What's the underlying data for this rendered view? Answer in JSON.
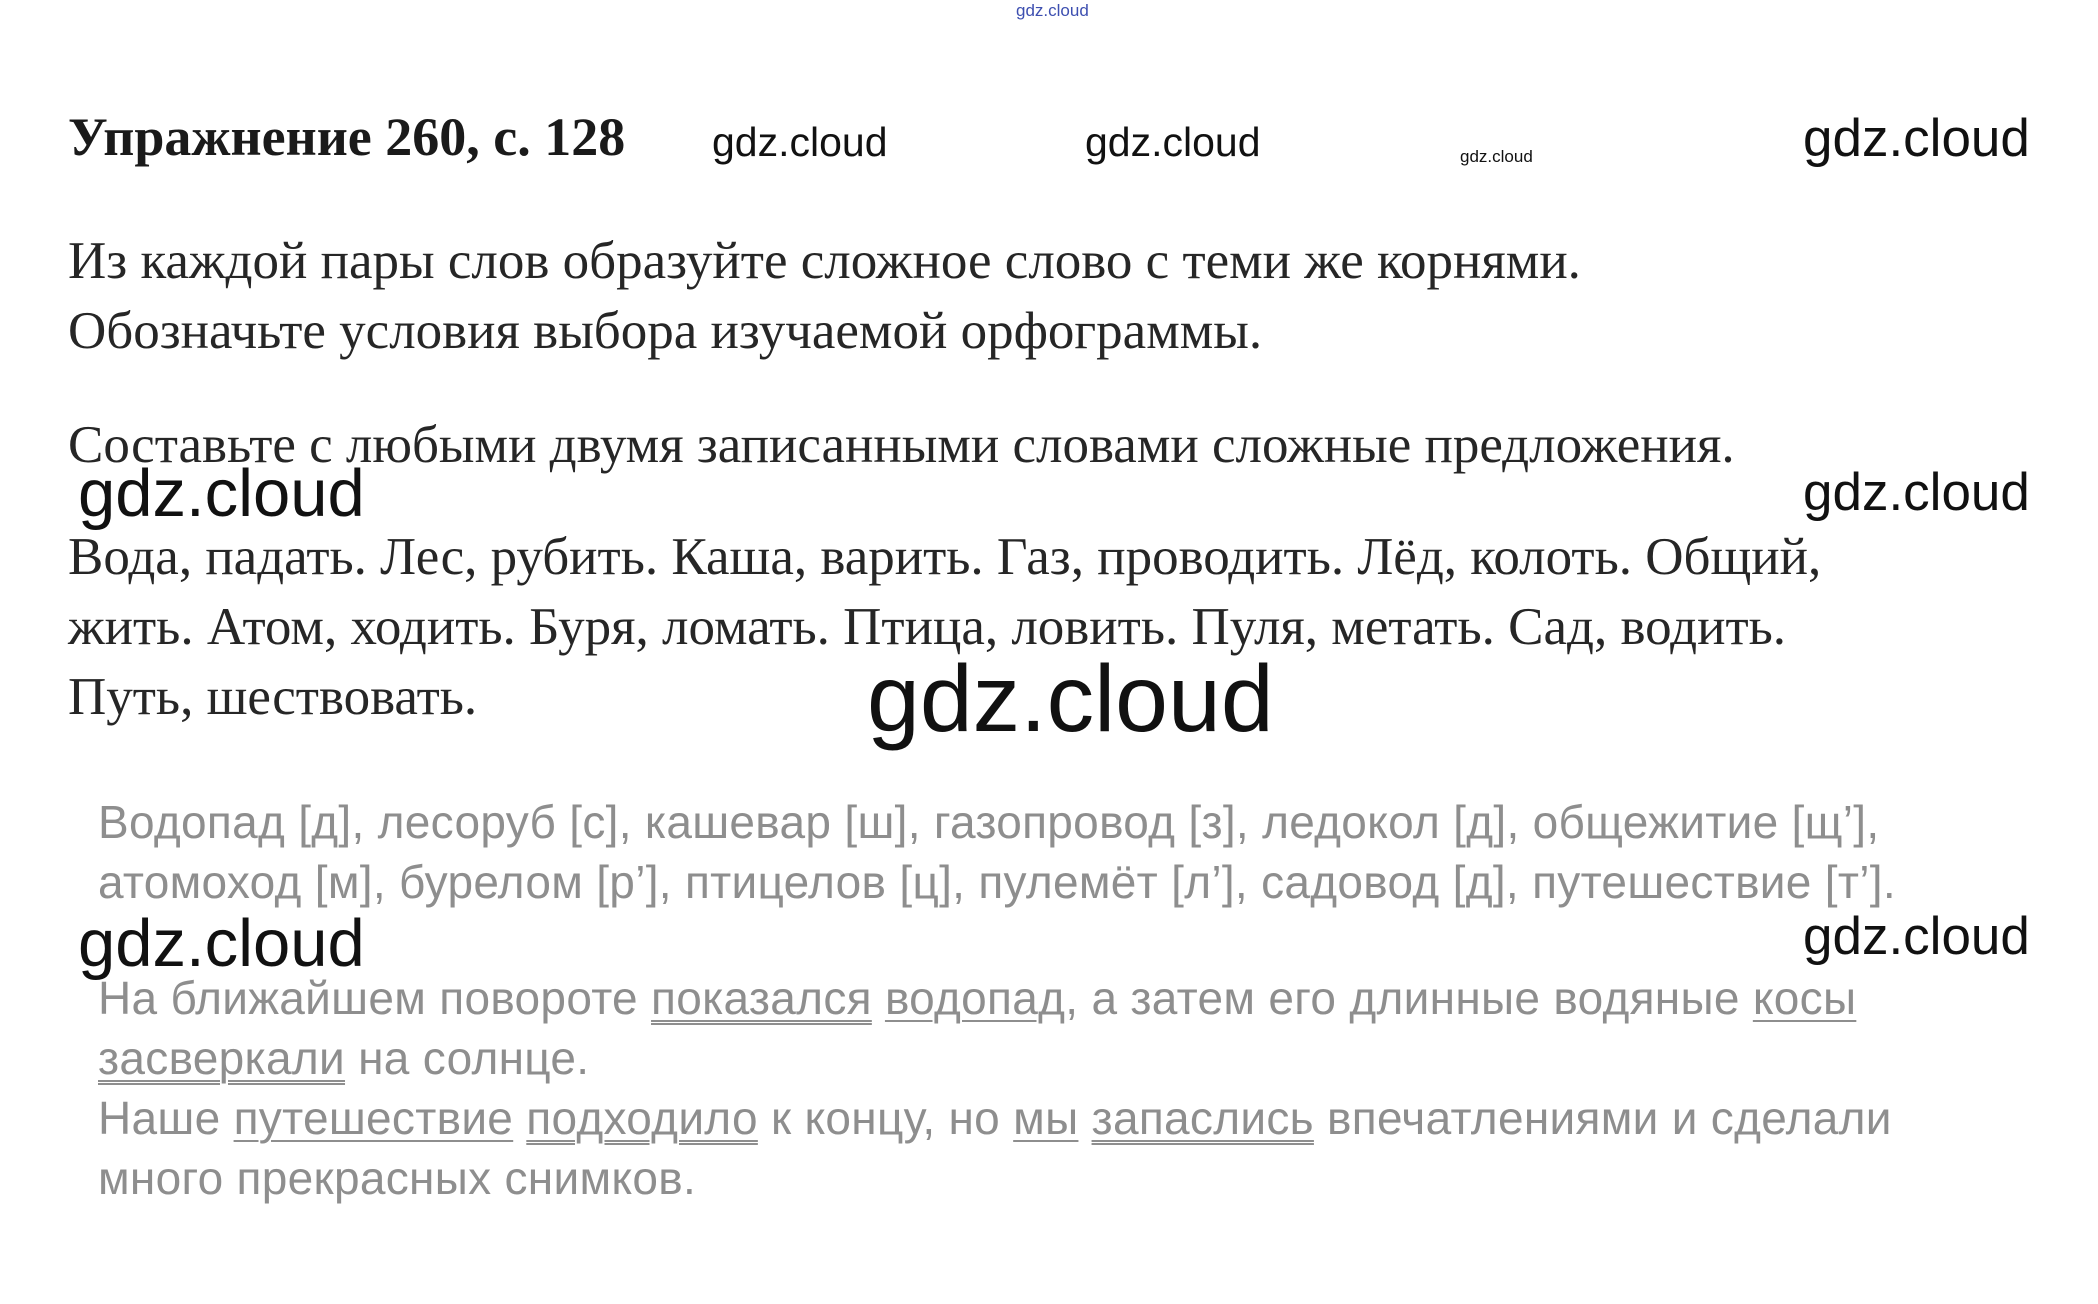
{
  "watermark": "gdz.cloud",
  "title": "Упражнение 260, с. 128",
  "task": {
    "line1": "Из каждой пары слов образуйте сложное слово с теми же корнями.",
    "line2": "Обозначьте условия выбора изучаемой орфограммы.",
    "line3": "Составьте с любыми двумя записанными словами сложные предложения."
  },
  "words": {
    "line1": "Вода, падать. Лес, рубить. Каша, варить. Газ, проводить. Лёд, колоть. Общий,",
    "line2": "жить. Атом, ходить. Буря, ломать. Птица, ловить. Пуля, метать. Сад, водить.",
    "line3": "Путь, шествовать."
  },
  "answer": {
    "line1": "Водопад [д], лесоруб [с], кашевар [ш], газопровод [з], ледокол [д], общежитие [щ’],",
    "line2": "атомоход [м], бурелом [р’], птицелов [ц], пулемёт [л’], садовод [д], путешествие [т’].",
    "sentence1": {
      "p1": "На ближайшем повороте ",
      "w1": "показался",
      "p2": " ",
      "w2": "водопад",
      "p3": ", а затем его длинные водяные ",
      "w3": "косы",
      "w4": "засверкали",
      "p4": " на солнце."
    },
    "sentence2": {
      "p1": "Наше ",
      "w1": "путешествие",
      "p2": " ",
      "w2": "подходило",
      "p3": " к концу, но ",
      "w3": "мы",
      "p4": " ",
      "w4": "запаслись",
      "p5": " впечатлениями и сделали",
      "line2": "много прекрасных снимков."
    }
  }
}
